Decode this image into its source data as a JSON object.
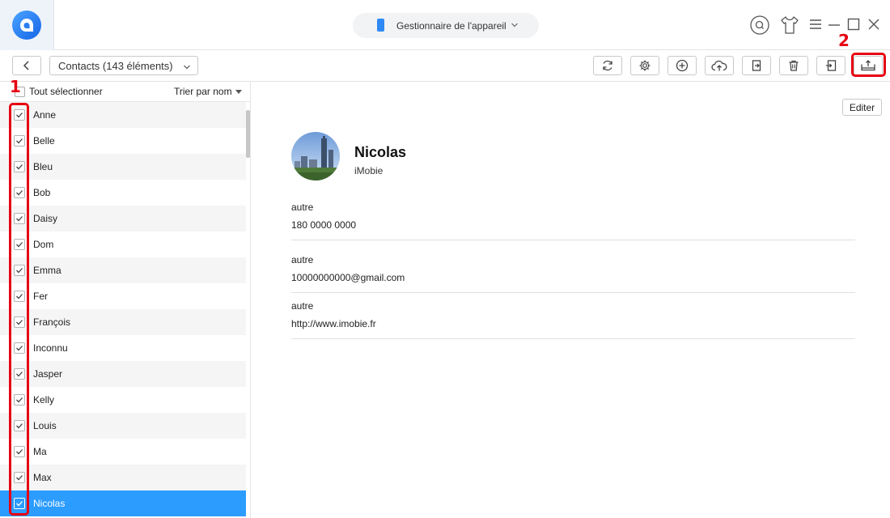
{
  "titlebar": {
    "device_label": "Gestionnaire de l'appareil"
  },
  "toolbar": {
    "contacts_label": "Contacts (143 éléments)",
    "icons": [
      "refresh-icon",
      "settings-icon",
      "add-icon",
      "upload-cloud-icon",
      "export-to-computer-icon",
      "delete-icon",
      "import-icon",
      "export-to-device-icon"
    ]
  },
  "annotations": {
    "step1": "1",
    "step2": "2",
    "highlight_color": "#e60012"
  },
  "list": {
    "select_all_label": "Tout sélectionner",
    "sort_label": "Trier par nom",
    "contacts": [
      "Anne",
      "Belle",
      "Bleu",
      "Bob",
      "Daisy",
      "Dom",
      "Emma",
      "Fer",
      "François",
      "Inconnu",
      "Jasper",
      "Kelly",
      "Louis",
      "Ma",
      "Max",
      "Nicolas"
    ],
    "selected_index": 15,
    "selection_color": "#2c9cff"
  },
  "detail": {
    "edit_label": "Editer",
    "name": "Nicolas",
    "organization": "iMobie",
    "fields": [
      {
        "label": "autre",
        "value": "180 0000 0000"
      },
      {
        "label": "autre",
        "value": "10000000000@gmail.com"
      },
      {
        "label": "autre",
        "value": "http://www.imobie.fr"
      }
    ]
  },
  "colors": {
    "accent": "#2f8af5"
  }
}
